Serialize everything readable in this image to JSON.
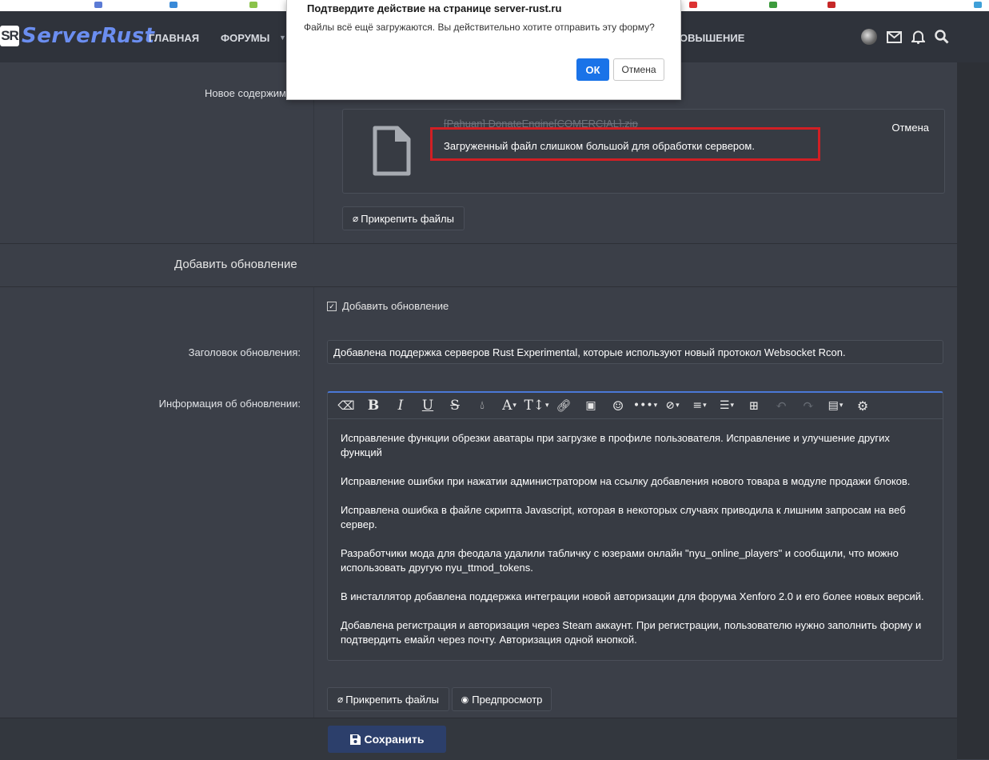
{
  "navbar": {
    "logo_badge": "SR",
    "logo_text": "ServerRust",
    "items": [
      "ГЛАВНАЯ",
      "ФОРУМЫ",
      "ОВЫШЕНИЕ"
    ]
  },
  "form": {
    "new_content_label": "Новое содержим",
    "file": {
      "name": "[Pahuan] DonateEngine[COMERCIAL].zip",
      "error": "Загруженный файл слишком большой для обработки сервером.",
      "cancel": "Отмена"
    },
    "attach_files": "Прикрепить файлы",
    "section_title": "Добавить обновление",
    "checkbox_label": "Добавить обновление",
    "update_title_label": "Заголовок обновления:",
    "update_title_value": "Добавлена поддержка серверов Rust Experimental, которые используют новый протокол Websocket Rcon.",
    "update_info_label": "Информация об обновлении:",
    "editor_paragraphs": [
      "Исправление функции обрезки аватары при загрузке в профиле пользователя. Исправление и улучшение других функций",
      "Исправление ошибки при нажатии администратором на ссылку добавления нового товара в модуле продажи блоков.",
      "Исправлена ошибка в файле скрипта Javascript, которая в некоторых случаях приводила к лишним запросам на веб сервер.",
      "Разработчики мода для феодала удалили табличку с юзерами онлайн \"nyu_online_players\" и сообщили, что можно использовать другую nyu_ttmod_tokens.",
      "В инсталлятор добавлена поддержка интеграции новой авторизации для форума Xenforo 2.0 и его более новых версий.",
      "Добавлена регистрация и авторизация через Steam аккаунт. При регистрации, пользователю нужно заполнить форму и подтвердить емайл через почту. Авторизация одной кнопкой."
    ],
    "attach_files_2": "Прикрепить файлы",
    "preview": "Предпросмотр",
    "save": "Сохранить"
  },
  "dialog": {
    "title": "Подтвердите действие на странице server-rust.ru",
    "message": "Файлы всё ещё загружаются. Вы действительно хотите отправить эту форму?",
    "ok": "ОК",
    "cancel": "Отмена"
  },
  "colors": {
    "accent": "#4a78d6",
    "error_highlight": "#d11f24",
    "dialog_ok": "#1a73e8"
  }
}
